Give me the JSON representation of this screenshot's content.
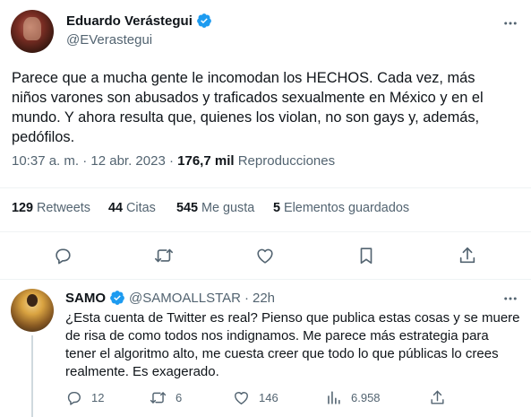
{
  "tweet": {
    "author_name": "Eduardo Verástegui",
    "author_handle": "@EVerastegui",
    "text": "Parece que a mucha gente le incomodan los HECHOS. Cada vez, más niños varones son abusados y traficados sexualmente en México y en el mundo. Y ahora resulta que, quienes los violan, no son gays y, además, pedófilos.",
    "time": "10:37 a. m.",
    "separator": "·",
    "date": "12 abr. 2023",
    "views_count": "176,7 mil",
    "views_label": "Reproducciones",
    "stats": {
      "retweets_count": "129",
      "retweets_label": "Retweets",
      "quotes_count": "44",
      "quotes_label": "Citas",
      "likes_count": "545",
      "likes_label": "Me gusta",
      "bookmarks_count": "5",
      "bookmarks_label": "Elementos guardados"
    },
    "actions": [
      "reply-icon",
      "retweet-icon",
      "like-icon",
      "bookmark-icon",
      "share-icon"
    ]
  },
  "reply": {
    "author_name": "SAMO",
    "author_handle": "@SAMOALLSTAR",
    "separator": "·",
    "time": "22h",
    "text": "¿Esta cuenta de Twitter es real? Pienso que publica estas cosas y se muere de risa de como todos nos indignamos. Me parece más estrategia para tener el algoritmo alto, me cuesta creer que todo lo que públicas lo crees realmente. Es exagerado.",
    "replies_count": "12",
    "retweets_count": "6",
    "likes_count": "146",
    "views_count": "6.958"
  },
  "colors": {
    "text_primary": "#0f1419",
    "text_secondary": "#536471",
    "verified_blue": "#1d9bf0",
    "border": "#eff3f4",
    "thread_line": "#cfd9de"
  }
}
